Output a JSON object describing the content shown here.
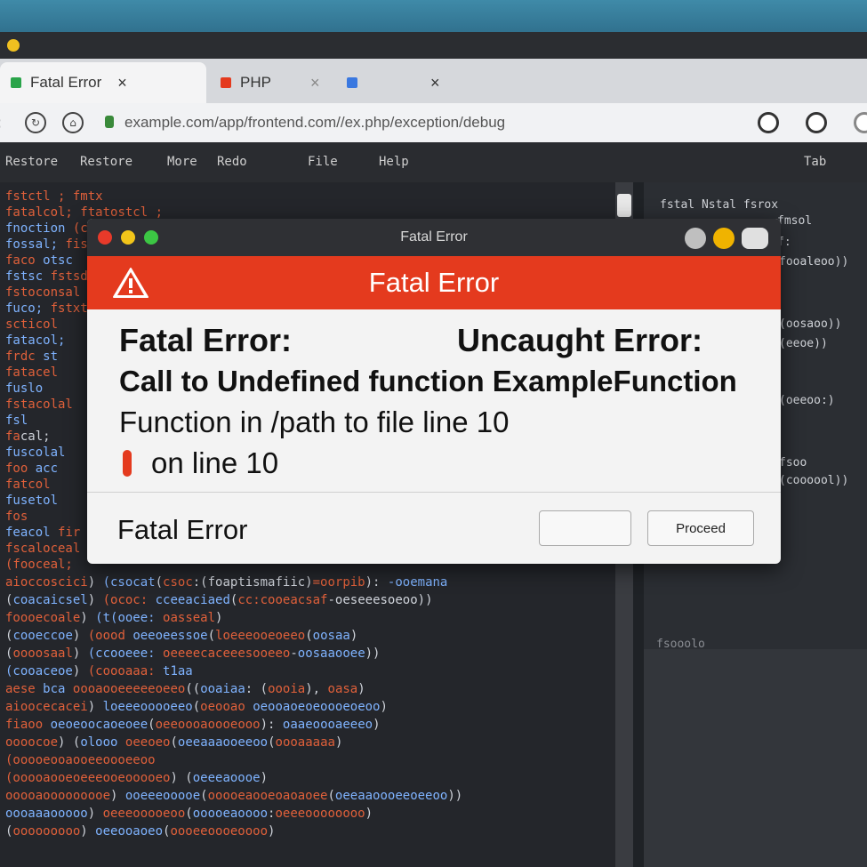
{
  "browser": {
    "tabs": [
      {
        "label": "Fatal Error",
        "favicon_color": "#2aa44a"
      },
      {
        "label": "PHP",
        "favicon_color": "#e43a1e"
      },
      {
        "label": "",
        "favicon_color": "#3a78e0"
      }
    ],
    "url": "example.com/app/frontend.com//ex.php/exception/debug",
    "close_glyph": "×"
  },
  "menubar": {
    "items": [
      "Restore",
      "Restore",
      "More",
      "Redo",
      "File",
      "Help"
    ],
    "right": "Tab"
  },
  "dialog": {
    "title": "Fatal Error",
    "header": "Fatal Error",
    "message": {
      "line1_left": "Fatal Error:",
      "line1_right": "Uncaught Error:",
      "line2": "Call to Undefined function ExampleFunction",
      "line3": "Function in /path to file line 10",
      "line4": "on line 10"
    },
    "footer_label": "Fatal Error",
    "buttons": {
      "secondary": "",
      "primary": "Proceed"
    }
  },
  "colors": {
    "accent_red": "#e43a1e",
    "titlebar_dark": "#2f3034",
    "editor_bg": "#24262b"
  }
}
